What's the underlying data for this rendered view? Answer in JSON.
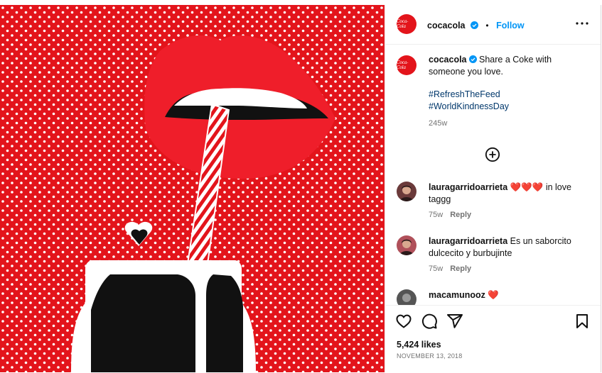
{
  "account": {
    "username": "cocacola",
    "follow_label": "Follow",
    "separator": "•",
    "brand_color": "#e3141b",
    "avatar_text": "Coca-Cola"
  },
  "caption": {
    "username": "cocacola",
    "text": "Share a Coke with someone you love.",
    "hashtags": [
      "#RefreshTheFeed",
      "#WorldKindnessDay"
    ],
    "age": "245w"
  },
  "load_more_icon": "plus-circle-icon",
  "comments": [
    {
      "username": "lauragarridoarrieta",
      "text": "❤️❤️❤️ in love taggg",
      "age": "75w",
      "reply_label": "Reply"
    },
    {
      "username": "lauragarridoarrieta",
      "text": "Es un saborcito dulcecito y burbujinte",
      "age": "75w",
      "reply_label": "Reply"
    },
    {
      "username": "macamunooz",
      "text": "❤️",
      "age": "",
      "reply_label": ""
    }
  ],
  "actions": [
    "heart-icon",
    "comment-icon",
    "share-icon",
    "bookmark-icon"
  ],
  "likes": "5,424 likes",
  "date": "NOVEMBER 13, 2018",
  "colors": {
    "link": "#00376b",
    "follow": "#0095f6",
    "muted": "#737373",
    "heart": "#e0245e"
  }
}
